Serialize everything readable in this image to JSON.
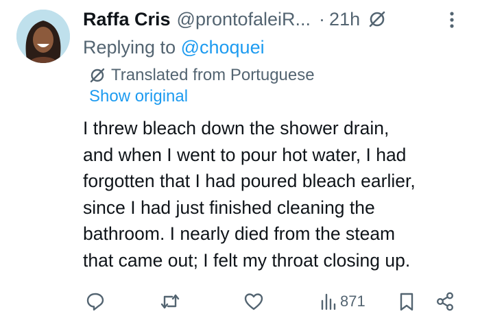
{
  "tweet": {
    "display_name": "Raffa Cris",
    "handle": "@prontofaleiR...",
    "separator": "·",
    "time": "21h",
    "reply_prefix": "Replying to ",
    "reply_mention": "@choquei",
    "translated_label": "Translated from Portuguese",
    "show_original": "Show original",
    "body_lines": [
      "I threw bleach down the shower drain,",
      "and when I went to pour hot water, I had",
      "forgotten that I had poured bleach earlier,",
      "since I had just finished cleaning the",
      "bathroom. I nearly died from the steam",
      "that came out; I felt my throat closing up."
    ],
    "views": "871"
  },
  "icons": {
    "header": [
      "translate-icon",
      "more-icon"
    ],
    "actions": [
      "reply-icon",
      "retweet-icon",
      "like-icon",
      "views-icon",
      "bookmark-icon",
      "share-icon"
    ]
  },
  "colors": {
    "text": "#0f1419",
    "secondary": "#536471",
    "link": "#1d9bf0",
    "background": "#ffffff"
  }
}
